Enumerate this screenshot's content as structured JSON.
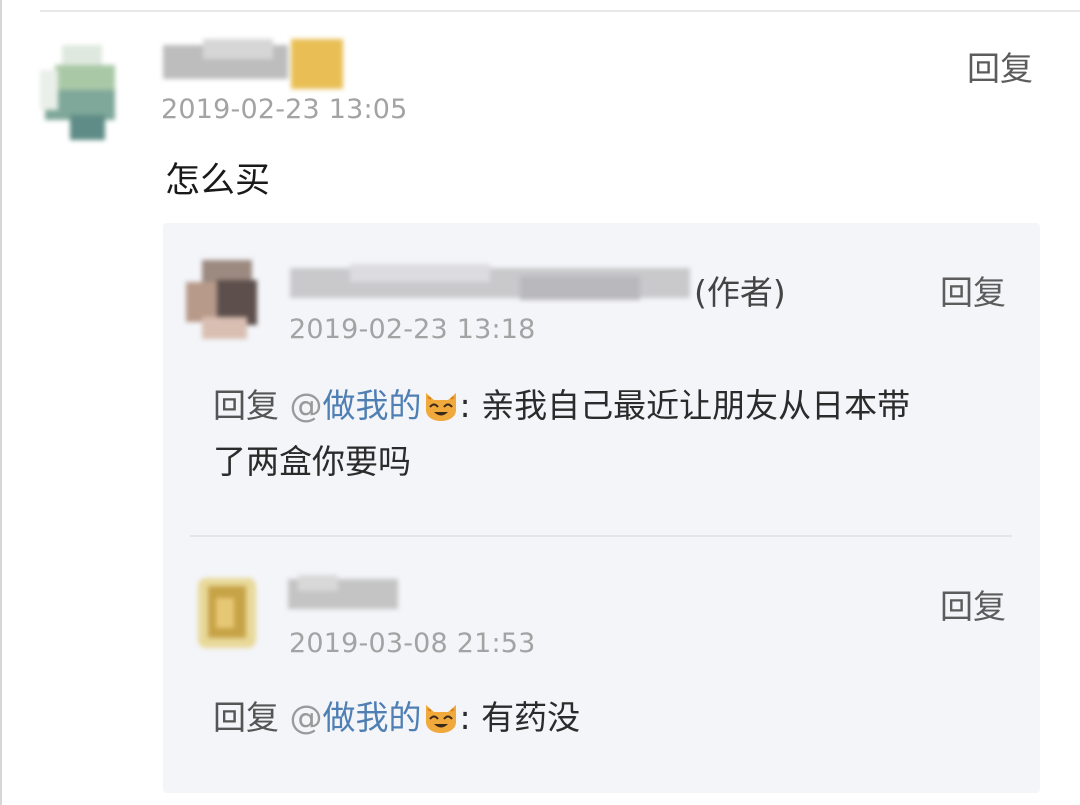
{
  "main_comment": {
    "timestamp": "2019-02-23 13:05",
    "text": "怎么买",
    "reply_label": "回复"
  },
  "replies": [
    {
      "author_tag": "(作者)",
      "timestamp": "2019-02-23 13:18",
      "reply_label": "回复",
      "prefix": "回复",
      "at": "@",
      "mention": "做我的",
      "mention_emoji": "cat-face-icon",
      "text_line1": ": 亲我自己最近让朋友从日本带",
      "text_line2": "了两盒你要吗"
    },
    {
      "timestamp": "2019-03-08 21:53",
      "reply_label": "回复",
      "prefix": "回复",
      "at": "@",
      "mention": "做我的",
      "mention_emoji": "cat-face-icon",
      "text_line1": ": 有药没"
    }
  ],
  "colors": {
    "mention": "#4f7fb3",
    "timestamp": "#a3a3a3",
    "reply_box": "#f4f5f9"
  }
}
